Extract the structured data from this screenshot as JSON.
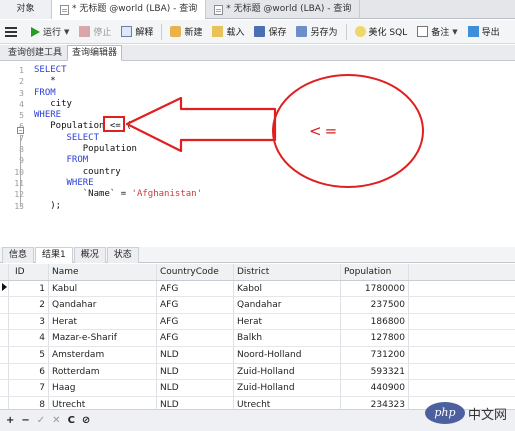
{
  "tabs": [
    {
      "label": "对象"
    },
    {
      "label": "* 无标题 @world (LBA) - 查询"
    },
    {
      "label": "* 无标题 @world (LBA) - 查询"
    }
  ],
  "toolbar": {
    "run": "运行",
    "stop": "停止",
    "explain": "解释",
    "new": "新建",
    "load": "载入",
    "save": "保存",
    "save_as": "另存为",
    "beautify": "美化 SQL",
    "comment": "备注",
    "export": "导出"
  },
  "subtabs": [
    "查询创建工具",
    "查询编辑器"
  ],
  "editor": {
    "line_numbers": [
      "1",
      "2",
      "3",
      "4",
      "5",
      "6",
      "7",
      "8",
      "9",
      "10",
      "11",
      "12",
      "13"
    ],
    "lines": [
      [
        {
          "t": "SELECT",
          "k": "kw"
        }
      ],
      [
        {
          "t": "   *",
          "k": ""
        }
      ],
      [
        {
          "t": "FROM",
          "k": "kw"
        }
      ],
      [
        {
          "t": "   city",
          "k": ""
        }
      ],
      [
        {
          "t": "WHERE",
          "k": "kw"
        }
      ],
      [
        {
          "t": "   Population <= (",
          "k": ""
        }
      ],
      [
        {
          "t": "      SELECT",
          "k": "kw"
        }
      ],
      [
        {
          "t": "         Population",
          "k": ""
        }
      ],
      [
        {
          "t": "      FROM",
          "k": "kw"
        }
      ],
      [
        {
          "t": "         country",
          "k": ""
        }
      ],
      [
        {
          "t": "      WHERE",
          "k": "kw"
        }
      ],
      [
        {
          "t": "         `Name` = ",
          "k": ""
        },
        {
          "t": "'Afghanistan'",
          "k": "str"
        }
      ],
      [
        {
          "t": "   );",
          "k": ""
        }
      ]
    ]
  },
  "annotation": {
    "label": "<=",
    "color": "#d61f1f"
  },
  "result_tabs": [
    "信息",
    "结果1",
    "概况",
    "状态"
  ],
  "grid": {
    "columns": [
      "ID",
      "Name",
      "CountryCode",
      "District",
      "Population"
    ],
    "rows": [
      [
        "1",
        "Kabul",
        "AFG",
        "Kabol",
        "1780000"
      ],
      [
        "2",
        "Qandahar",
        "AFG",
        "Qandahar",
        "237500"
      ],
      [
        "3",
        "Herat",
        "AFG",
        "Herat",
        "186800"
      ],
      [
        "4",
        "Mazar-e-Sharif",
        "AFG",
        "Balkh",
        "127800"
      ],
      [
        "5",
        "Amsterdam",
        "NLD",
        "Noord-Holland",
        "731200"
      ],
      [
        "6",
        "Rotterdam",
        "NLD",
        "Zuid-Holland",
        "593321"
      ],
      [
        "7",
        "Haag",
        "NLD",
        "Zuid-Holland",
        "440900"
      ],
      [
        "8",
        "Utrecht",
        "NLD",
        "Utrecht",
        "234323"
      ]
    ]
  },
  "bottom_toolbar": [
    "+",
    "−",
    "✓",
    "✕",
    "C",
    "⊘"
  ],
  "watermark": {
    "logo": "php",
    "text": "中文网"
  }
}
